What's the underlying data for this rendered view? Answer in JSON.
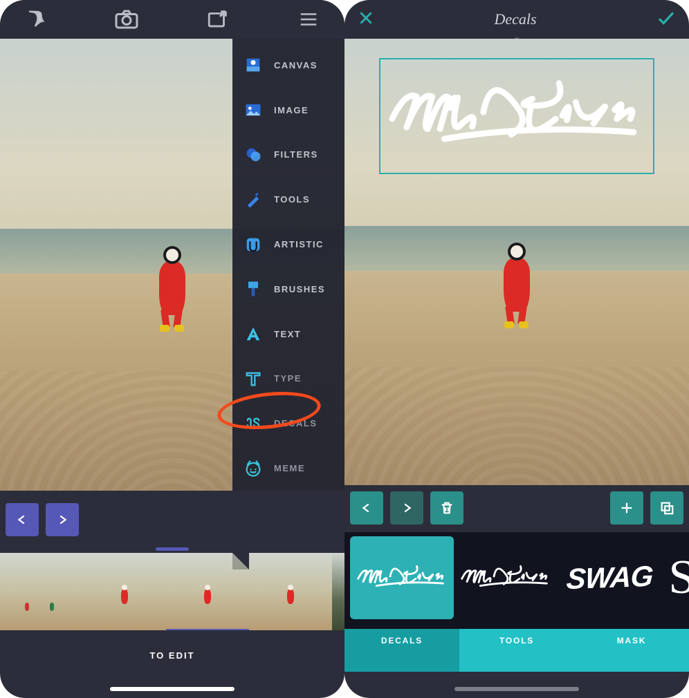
{
  "left": {
    "topbar_icons": [
      "logo",
      "camera",
      "share",
      "menu"
    ],
    "menu": [
      {
        "icon": "canvas",
        "label": "CANVAS"
      },
      {
        "icon": "image",
        "label": "IMAGE"
      },
      {
        "icon": "filters",
        "label": "FILTERS"
      },
      {
        "icon": "tools",
        "label": "TOOLS"
      },
      {
        "icon": "artistic",
        "label": "ARTISTIC"
      },
      {
        "icon": "brushes",
        "label": "BRUSHES"
      },
      {
        "icon": "text",
        "label": "TEXT"
      },
      {
        "icon": "type",
        "label": "TYPE"
      },
      {
        "icon": "decals",
        "label": "DECALS",
        "highlighted": true
      },
      {
        "icon": "meme",
        "label": "MEME"
      }
    ],
    "to_edit_label": "TO EDIT"
  },
  "right": {
    "close_icon": "close",
    "confirm_icon": "check",
    "title": "Decals",
    "placed_decal": "Wild & Free",
    "toolbar_left": [
      "undo",
      "redo",
      "delete"
    ],
    "toolbar_right": [
      "add",
      "duplicate"
    ],
    "decals_strip": [
      "Wild & Free",
      "Wild & Free",
      "SWAG",
      "S"
    ],
    "tabs": [
      "DECALS",
      "TOOLS",
      "MASK"
    ],
    "selected_tab_index": 0,
    "selected_decal_index": 0
  },
  "colors": {
    "purple": "#5658b6",
    "teal": "#2b8f8a",
    "teal_light": "#23c0c6",
    "highlight_circle": "#f24a1d"
  }
}
